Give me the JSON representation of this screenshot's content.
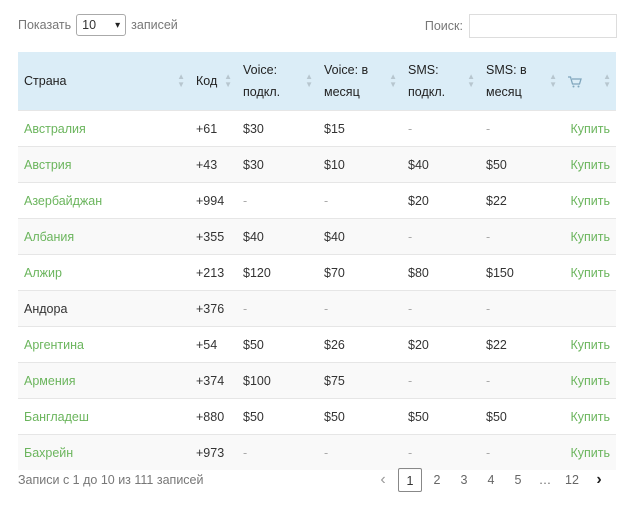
{
  "length_control": {
    "prefix": "Показать",
    "value": "10",
    "suffix": "записей"
  },
  "search": {
    "label": "Поиск:",
    "value": ""
  },
  "columns": [
    "Страна",
    "Код",
    "Voice: подкл.",
    "Voice: в месяц",
    "SMS: подкл.",
    "SMS: в месяц",
    "cart-icon"
  ],
  "rows": [
    {
      "country": "Австралия",
      "code": "+61",
      "v1": "$30",
      "v2": "$15",
      "s1": "-",
      "s2": "-",
      "buy": "Купить",
      "link": true
    },
    {
      "country": "Австрия",
      "code": "+43",
      "v1": "$30",
      "v2": "$10",
      "s1": "$40",
      "s2": "$50",
      "buy": "Купить",
      "link": true
    },
    {
      "country": "Азербайджан",
      "code": "+994",
      "v1": "-",
      "v2": "-",
      "s1": "$20",
      "s2": "$22",
      "buy": "Купить",
      "link": true
    },
    {
      "country": "Албания",
      "code": "+355",
      "v1": "$40",
      "v2": "$40",
      "s1": "-",
      "s2": "-",
      "buy": "Купить",
      "link": true
    },
    {
      "country": "Алжир",
      "code": "+213",
      "v1": "$120",
      "v2": "$70",
      "s1": "$80",
      "s2": "$150",
      "buy": "Купить",
      "link": true
    },
    {
      "country": "Андора",
      "code": "+376",
      "v1": "-",
      "v2": "-",
      "s1": "-",
      "s2": "-",
      "buy": "",
      "link": false
    },
    {
      "country": "Аргентина",
      "code": "+54",
      "v1": "$50",
      "v2": "$26",
      "s1": "$20",
      "s2": "$22",
      "buy": "Купить",
      "link": true
    },
    {
      "country": "Армения",
      "code": "+374",
      "v1": "$100",
      "v2": "$75",
      "s1": "-",
      "s2": "-",
      "buy": "Купить",
      "link": true
    },
    {
      "country": "Бангладеш",
      "code": "+880",
      "v1": "$50",
      "v2": "$50",
      "s1": "$50",
      "s2": "$50",
      "buy": "Купить",
      "link": true
    },
    {
      "country": "Бахрейн",
      "code": "+973",
      "v1": "-",
      "v2": "-",
      "s1": "-",
      "s2": "-",
      "buy": "Купить",
      "link": true
    }
  ],
  "info": "Записи с 1 до 10 из 111 записей",
  "pagination": {
    "prev": "‹",
    "pages": [
      "1",
      "2",
      "3",
      "4",
      "5",
      "…",
      "12"
    ],
    "current": "1",
    "next": "›"
  },
  "colors": {
    "header_bg": "#dbedf7",
    "link": "#6bb55d",
    "stripe": "#f9f9f9"
  }
}
